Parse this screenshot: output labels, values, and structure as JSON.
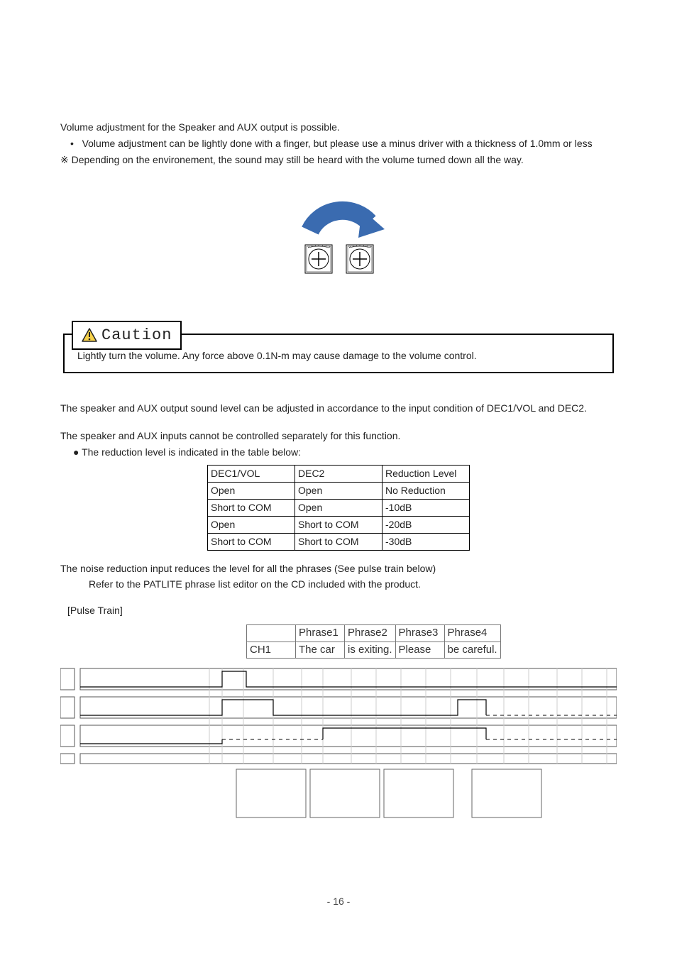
{
  "intro": {
    "line1": "Volume adjustment for the Speaker and AUX output is possible.",
    "line2_bullet": "•",
    "line2": "Volume adjustment can be lightly done with a finger, but please use a minus driver with a thickness of 1.0mm or less",
    "line3_mark": "※",
    "line3": "Depending on the environement, the sound may still be heard with the volume turned down all the way."
  },
  "caution": {
    "label": "Caution",
    "body": "Lightly turn the volume.  Any force above 0.1N-m may cause damage to the volume control."
  },
  "mid": {
    "p1": "The speaker and AUX output sound level can be adjusted in accordance to the input condition of DEC1/VOL and DEC2.",
    "p2": "The speaker and AUX inputs cannot be controlled separately for this function.",
    "p3": "● The reduction level is indicated in the table below:"
  },
  "reduction_table": {
    "headers": [
      "DEC1/VOL",
      "DEC2",
      "Reduction Level"
    ],
    "rows": [
      [
        "Open",
        "Open",
        "No Reduction"
      ],
      [
        "Short to COM",
        "Open",
        "-10dB"
      ],
      [
        "Open",
        "Short to COM",
        "-20dB"
      ],
      [
        "Short to COM",
        "Short to COM",
        "-30dB"
      ]
    ]
  },
  "bottom": {
    "p1": "The noise reduction input reduces the level for all the phrases (See pulse train below)",
    "p2": "Refer to the PATLITE phrase list editor on the CD included with the product.",
    "pulse_label": "[Pulse Train]"
  },
  "phrase_table": {
    "row1": [
      "",
      "Phrase1",
      "Phrase2",
      "Phrase3",
      "Phrase4"
    ],
    "row2": [
      "CH1",
      "The car",
      "is exiting.",
      "Please",
      "be careful."
    ]
  },
  "page_number": "- 16 -",
  "colors": {
    "arrow": "#3a6bb0",
    "caution_tri_fill": "#f7d24a",
    "caution_tri_border": "#222"
  }
}
